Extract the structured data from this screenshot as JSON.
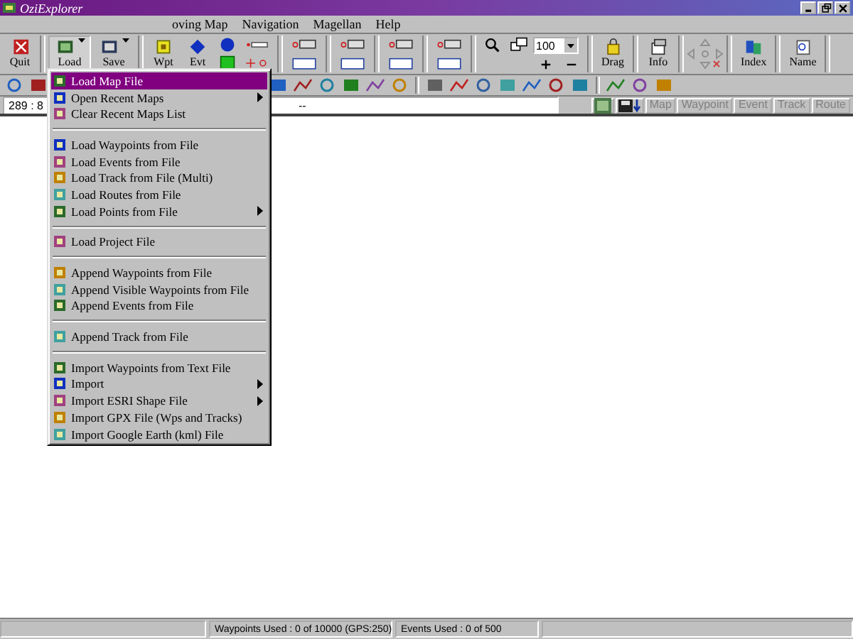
{
  "window": {
    "title": "OziExplorer"
  },
  "menu_bar": [
    "oving Map",
    "Navigation",
    "Magellan",
    "Help"
  ],
  "toolbar": {
    "buttons": [
      {
        "label": "Quit",
        "caret": false,
        "pressed": false
      },
      {
        "label": "Load",
        "caret": true,
        "pressed": true
      },
      {
        "label": "Save",
        "caret": true,
        "pressed": false
      },
      {
        "label": "Wpt",
        "caret": false,
        "pressed": false
      },
      {
        "label": "Evt",
        "caret": false,
        "pressed": false
      },
      {
        "label": "Drag",
        "caret": false,
        "pressed": false
      },
      {
        "label": "Info",
        "caret": false,
        "pressed": false
      },
      {
        "label": "Index",
        "caret": false,
        "pressed": false
      },
      {
        "label": "Name",
        "caret": false,
        "pressed": false
      }
    ],
    "zoom": {
      "value": "100"
    }
  },
  "position_bar": {
    "position": "289 : 8",
    "center_text": "--",
    "view_buttons": [
      {
        "label": "Map",
        "disabled": true
      },
      {
        "label": "Waypoint",
        "disabled": true
      },
      {
        "label": "Event",
        "disabled": true
      },
      {
        "label": "Track",
        "disabled": true
      },
      {
        "label": "Route",
        "disabled": true
      }
    ]
  },
  "load_menu": {
    "groups": [
      [
        {
          "label": "Load Map File",
          "selected": true,
          "submenu": false
        },
        {
          "label": "Open Recent Maps",
          "selected": false,
          "submenu": true
        },
        {
          "label": "Clear Recent Maps List",
          "selected": false,
          "submenu": false
        }
      ],
      [
        {
          "label": "Load Waypoints from File",
          "selected": false,
          "submenu": false
        },
        {
          "label": "Load Events from File",
          "selected": false,
          "submenu": false
        },
        {
          "label": "Load Track from File (Multi)",
          "selected": false,
          "submenu": false
        },
        {
          "label": "Load Routes from File",
          "selected": false,
          "submenu": false
        },
        {
          "label": "Load Points from File",
          "selected": false,
          "submenu": true
        }
      ],
      [
        {
          "label": "Load Project File",
          "selected": false,
          "submenu": false
        }
      ],
      [
        {
          "label": "Append Waypoints from File",
          "selected": false,
          "submenu": false
        },
        {
          "label": "Append Visible Waypoints from File",
          "selected": false,
          "submenu": false
        },
        {
          "label": "Append Events from File",
          "selected": false,
          "submenu": false
        }
      ],
      [
        {
          "label": "Append Track from File",
          "selected": false,
          "submenu": false
        }
      ],
      [
        {
          "label": "Import Waypoints from Text File",
          "selected": false,
          "submenu": false
        },
        {
          "label": "Import",
          "selected": false,
          "submenu": true
        },
        {
          "label": "Import ESRI Shape File",
          "selected": false,
          "submenu": true
        },
        {
          "label": "Import GPX File (Wps and Tracks)",
          "selected": false,
          "submenu": false
        },
        {
          "label": "Import Google Earth (kml) File",
          "selected": false,
          "submenu": false
        }
      ]
    ]
  },
  "status_bar": [
    "Waypoints Used : 0 of 10000  (GPS:250)",
    "Events Used : 0 of 500"
  ]
}
